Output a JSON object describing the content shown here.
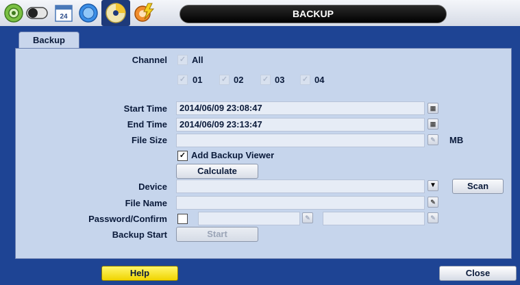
{
  "header": {
    "title": "BACKUP",
    "icons": [
      "setup-gear-icon",
      "record-toggle-icon",
      "calendar-icon",
      "network-globe-icon",
      "backup-disc-icon",
      "event-gear-icon"
    ],
    "calendar_glyph": "24"
  },
  "tabs": [
    {
      "label": "Backup",
      "active": true
    }
  ],
  "form": {
    "channel_label": "Channel",
    "all_label": "All",
    "channels": [
      "01",
      "02",
      "03",
      "04"
    ],
    "start_time_label": "Start Time",
    "start_time_value": "2014/06/09 23:08:47",
    "end_time_label": "End Time",
    "end_time_value": "2014/06/09 23:13:47",
    "file_size_label": "File Size",
    "file_size_value": "",
    "file_size_unit": "MB",
    "add_viewer_label": "Add Backup Viewer",
    "add_viewer_checked": true,
    "calculate_label": "Calculate",
    "device_label": "Device",
    "device_value": "",
    "scan_label": "Scan",
    "file_name_label": "File Name",
    "file_name_value": "",
    "password_label": "Password/Confirm",
    "backup_start_label": "Backup Start",
    "start_label": "Start"
  },
  "footer": {
    "help_label": "Help",
    "close_label": "Close"
  },
  "colors": {
    "frame": "#1e4494",
    "panel": "#c6d5ec",
    "help_button": "#f5e000",
    "title_bar": "#000000"
  }
}
